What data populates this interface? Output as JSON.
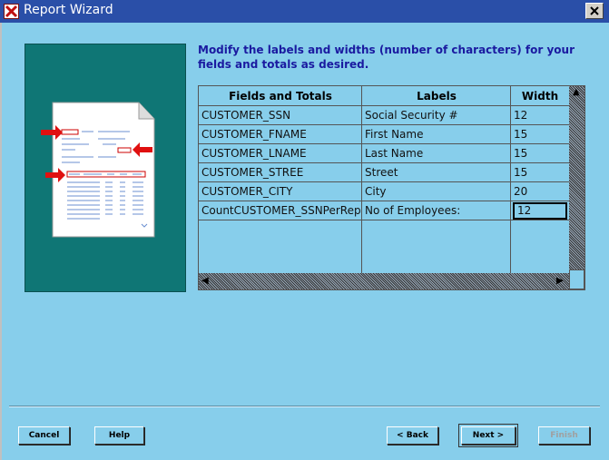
{
  "window": {
    "title": "Report Wizard"
  },
  "instructions": "Modify the labels and widths (number of characters) for your fields and totals as desired.",
  "table": {
    "columns": [
      "Fields and Totals",
      "Labels",
      "Width"
    ],
    "rows": [
      {
        "field": "CUSTOMER_SSN",
        "label": "Social Security #",
        "width": "12"
      },
      {
        "field": "CUSTOMER_FNAME",
        "label": "First Name",
        "width": "15"
      },
      {
        "field": "CUSTOMER_LNAME",
        "label": "Last Name",
        "width": "15"
      },
      {
        "field": "CUSTOMER_STREE",
        "label": "Street",
        "width": "15"
      },
      {
        "field": "CUSTOMER_CITY",
        "label": "City",
        "width": "20"
      },
      {
        "field": "CountCUSTOMER_SSNPerRep",
        "label": "No of Employees:",
        "width": "12"
      }
    ]
  },
  "buttons": {
    "cancel": "Cancel",
    "help": "Help",
    "back": "< Back",
    "next": "Next >",
    "finish": "Finish"
  },
  "colors": {
    "background": "#87CEEB",
    "titlebar": "#2a4fa8",
    "illustration": "#0f7675",
    "instructions": "#1a1aa0"
  }
}
